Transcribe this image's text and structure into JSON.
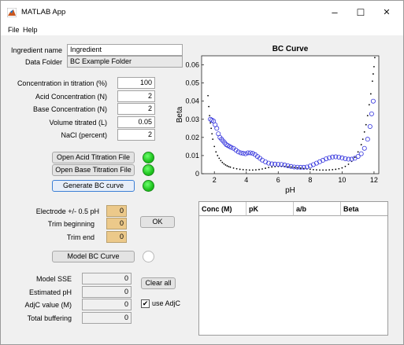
{
  "window": {
    "title": "MATLAB App",
    "minimize": "–",
    "maximize": "☐",
    "close": "✕"
  },
  "menu": {
    "file": "File",
    "help": "Help"
  },
  "ingredient": {
    "name_label": "Ingredient name",
    "name_value": "Ingredient",
    "folder_label": "Data Folder",
    "folder_value": "BC Example Folder"
  },
  "params": [
    {
      "label": "Concentration in titration (%)",
      "value": "100"
    },
    {
      "label": "Acid Concentration (N)",
      "value": "2"
    },
    {
      "label": "Base Concentration (N)",
      "value": "2"
    },
    {
      "label": "Volume titrated (L)",
      "value": "0.05"
    },
    {
      "label": "NaCl (percent)",
      "value": "2"
    }
  ],
  "buttons": {
    "open_acid": "Open Acid Titration File",
    "open_base": "Open Base Titration File",
    "generate": "Generate BC curve",
    "ok": "OK",
    "model": "Model BC Curve",
    "clear_all": "Clear all"
  },
  "trim": {
    "electrode_label": "Electrode +/- 0.5 pH",
    "electrode_value": "0",
    "begin_label": "Trim beginning",
    "begin_value": "0",
    "end_label": "Trim end",
    "end_value": "0"
  },
  "results": [
    {
      "label": "Model SSE",
      "value": "0"
    },
    {
      "label": "Estimated pH",
      "value": "0"
    },
    {
      "label": "AdjC value (M)",
      "value": "0"
    },
    {
      "label": "Total buffering",
      "value": "0"
    }
  ],
  "use_adjc": {
    "label": "use AdjC",
    "checked": true,
    "mark": "✔"
  },
  "table": {
    "columns": [
      "Conc (M)",
      "pK",
      "a/b",
      "Beta"
    ]
  },
  "colors": {
    "lamp_on": "#1fc41f",
    "tan_field": "#ecc98a",
    "scatter_blue": "#3333dd"
  },
  "chart_data": {
    "type": "scatter",
    "title": "BC Curve",
    "xlabel": "pH",
    "ylabel": "Beta",
    "xlim": [
      1.2,
      12.3
    ],
    "ylim": [
      0,
      0.065
    ],
    "xticks": [
      2,
      4,
      6,
      8,
      10,
      12
    ],
    "yticks": [
      0,
      0.01,
      0.02,
      0.03,
      0.04,
      0.05,
      0.06
    ],
    "ytick_labels": [
      "0",
      "0.01",
      "0.02",
      "0.03",
      "0.04",
      "0.05",
      "0.06"
    ],
    "series": [
      {
        "marker": "dot",
        "color": "#000000",
        "x": [
          1.6,
          1.65,
          1.7,
          1.75,
          1.8,
          1.85,
          1.9,
          2.0,
          2.1,
          2.2,
          2.3,
          2.4,
          2.5,
          2.6,
          2.7,
          2.8,
          2.9,
          3.0,
          3.2,
          3.4,
          3.6,
          3.8,
          4.0,
          4.2,
          4.4,
          4.6,
          4.8,
          5.0,
          5.2,
          5.4,
          5.6,
          5.8,
          6.0,
          6.2,
          6.4,
          6.6,
          6.8,
          7.0,
          7.2,
          7.4,
          7.6,
          7.8,
          8.0,
          8.2,
          8.4,
          8.6,
          8.8,
          9.0,
          9.2,
          9.4,
          9.6,
          9.8,
          10.0,
          10.2,
          10.4,
          10.6,
          10.8,
          11.0,
          11.2,
          11.3,
          11.4,
          11.5,
          11.6,
          11.7,
          11.8,
          11.9,
          11.95,
          12.0,
          12.05
        ],
        "y": [
          0.043,
          0.037,
          0.032,
          0.028,
          0.025,
          0.022,
          0.019,
          0.015,
          0.012,
          0.01,
          0.0085,
          0.0072,
          0.0062,
          0.0054,
          0.0048,
          0.0043,
          0.0039,
          0.0036,
          0.0031,
          0.0027,
          0.0024,
          0.0022,
          0.0021,
          0.002,
          0.002,
          0.0021,
          0.0023,
          0.0026,
          0.003,
          0.0034,
          0.0037,
          0.0039,
          0.004,
          0.004,
          0.0039,
          0.0038,
          0.0036,
          0.0034,
          0.0032,
          0.003,
          0.0028,
          0.0026,
          0.0024,
          0.0022,
          0.0021,
          0.002,
          0.002,
          0.002,
          0.0021,
          0.0022,
          0.0024,
          0.0027,
          0.0032,
          0.004,
          0.0052,
          0.0068,
          0.009,
          0.012,
          0.016,
          0.019,
          0.023,
          0.027,
          0.032,
          0.038,
          0.044,
          0.051,
          0.055,
          0.059,
          0.064
        ]
      },
      {
        "marker": "circle",
        "color": "#3333dd",
        "x": [
          1.75,
          1.85,
          1.95,
          2.05,
          2.15,
          2.25,
          2.35,
          2.45,
          2.55,
          2.65,
          2.75,
          2.85,
          2.95,
          3.05,
          3.2,
          3.35,
          3.5,
          3.65,
          3.8,
          3.95,
          4.1,
          4.25,
          4.4,
          4.55,
          4.7,
          4.85,
          5.0,
          5.2,
          5.4,
          5.6,
          5.8,
          6.0,
          6.2,
          6.4,
          6.6,
          6.8,
          7.0,
          7.2,
          7.4,
          7.6,
          7.8,
          8.0,
          8.2,
          8.4,
          8.6,
          8.8,
          9.0,
          9.2,
          9.4,
          9.6,
          9.8,
          10.0,
          10.2,
          10.4,
          10.6,
          10.8,
          11.0,
          11.2,
          11.4,
          11.6,
          11.75,
          11.85,
          11.95
        ],
        "y": [
          0.03,
          0.0295,
          0.029,
          0.027,
          0.025,
          0.022,
          0.02,
          0.019,
          0.018,
          0.017,
          0.016,
          0.0155,
          0.015,
          0.0145,
          0.014,
          0.013,
          0.012,
          0.0115,
          0.0112,
          0.011,
          0.0115,
          0.0115,
          0.0112,
          0.0105,
          0.0095,
          0.0085,
          0.0075,
          0.0065,
          0.0058,
          0.0054,
          0.0053,
          0.0052,
          0.0051,
          0.0048,
          0.0044,
          0.004,
          0.0037,
          0.0036,
          0.0035,
          0.0035,
          0.0037,
          0.0042,
          0.005,
          0.0058,
          0.0066,
          0.0074,
          0.0082,
          0.0088,
          0.0092,
          0.0093,
          0.0091,
          0.0087,
          0.0083,
          0.008,
          0.008,
          0.0085,
          0.0095,
          0.011,
          0.014,
          0.019,
          0.026,
          0.033,
          0.04
        ]
      }
    ]
  }
}
